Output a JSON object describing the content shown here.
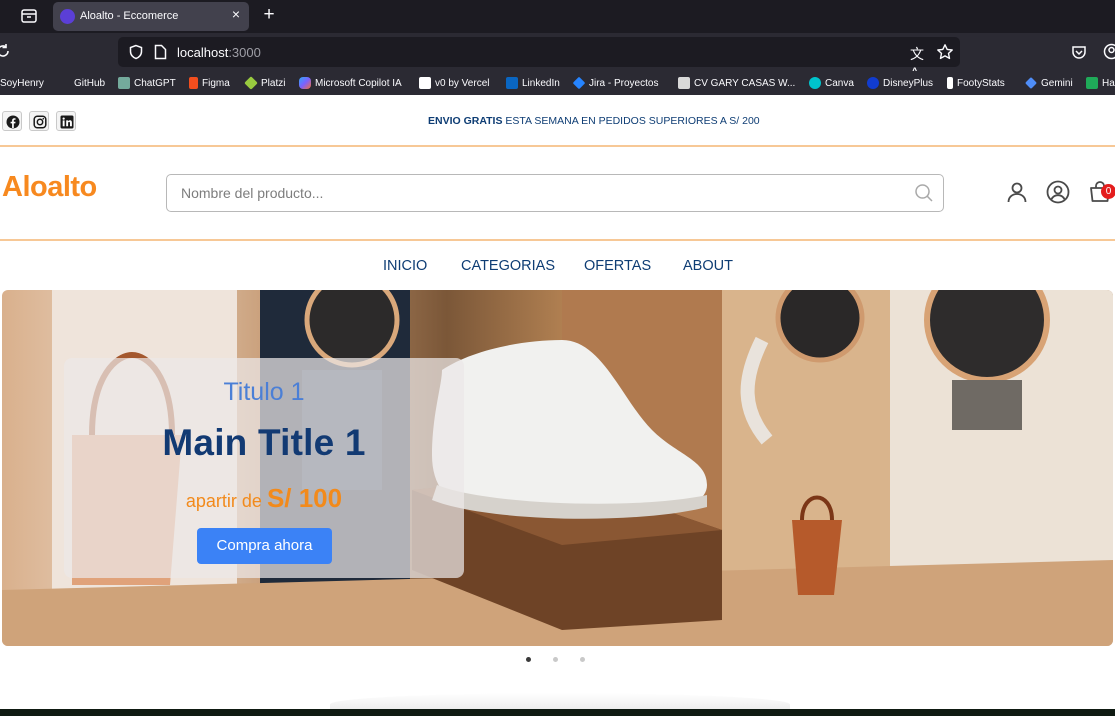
{
  "browser": {
    "tab": {
      "title": "Aloalto - Eccomerce",
      "close_glyph": "×"
    },
    "new_tab_glyph": "+",
    "url": {
      "host": "localhost",
      "port": ":3000"
    },
    "translate_glyph": "文A",
    "bookmarks": [
      {
        "label": "SoyHenry",
        "icon": "none",
        "color": ""
      },
      {
        "label": "GitHub",
        "icon": "none",
        "color": ""
      },
      {
        "label": "ChatGPT",
        "icon": "chatgpt-icon",
        "color": "#74aa9c"
      },
      {
        "label": "Figma",
        "icon": "figma-icon",
        "color": "#f24e1e"
      },
      {
        "label": "Platzi",
        "icon": "platzi-icon",
        "color": "#98ca3f"
      },
      {
        "label": "Microsoft Copilot IA",
        "icon": "copilot-icon",
        "color": "#7b61ff"
      },
      {
        "label": "v0 by Vercel",
        "icon": "v0-icon",
        "color": "#ffffff"
      },
      {
        "label": "LinkedIn",
        "icon": "linkedin-icon",
        "color": "#0a66c2"
      },
      {
        "label": "Jira - Proyectos",
        "icon": "jira-icon",
        "color": "#2684ff"
      },
      {
        "label": "CV GARY CASAS W...",
        "icon": "folder-icon",
        "color": "#d9d9d9"
      },
      {
        "label": "Canva",
        "icon": "canva-icon",
        "color": "#00c4cc"
      },
      {
        "label": "DisneyPlus",
        "icon": "disney-icon",
        "color": "#113ccf"
      },
      {
        "label": "FootyStats",
        "icon": "footystats-icon",
        "color": "#ffffff"
      },
      {
        "label": "Gemini",
        "icon": "gemini-icon",
        "color": "#4f8df7"
      },
      {
        "label": "Ha",
        "icon": "ha-icon",
        "color": "#1faa59"
      }
    ]
  },
  "topbar": {
    "social": [
      "facebook-icon",
      "instagram-icon",
      "linkedin-icon"
    ],
    "promo_bold": "ENVIO GRATIS",
    "promo_rest": " ESTA SEMANA EN PEDIDOS SUPERIORES A S/ 200"
  },
  "header": {
    "logo": "Aloalto",
    "search_placeholder": "Nombre del producto...",
    "cart_count": "0"
  },
  "menu": [
    "INICIO",
    "CATEGORIAS",
    "OFERTAS",
    "ABOUT"
  ],
  "hero": {
    "subtitle": "Titulo 1",
    "title": "Main Title 1",
    "price_prefix": "apartir de ",
    "price": "S/ 100",
    "cta": "Compra ahora"
  },
  "carousel": {
    "slide_count": 3,
    "active_index": 0
  },
  "colors": {
    "accent_orange": "#f7891f",
    "navy": "#123a73",
    "cta_blue": "#3b82f6",
    "badge_red": "#e41d1d"
  }
}
